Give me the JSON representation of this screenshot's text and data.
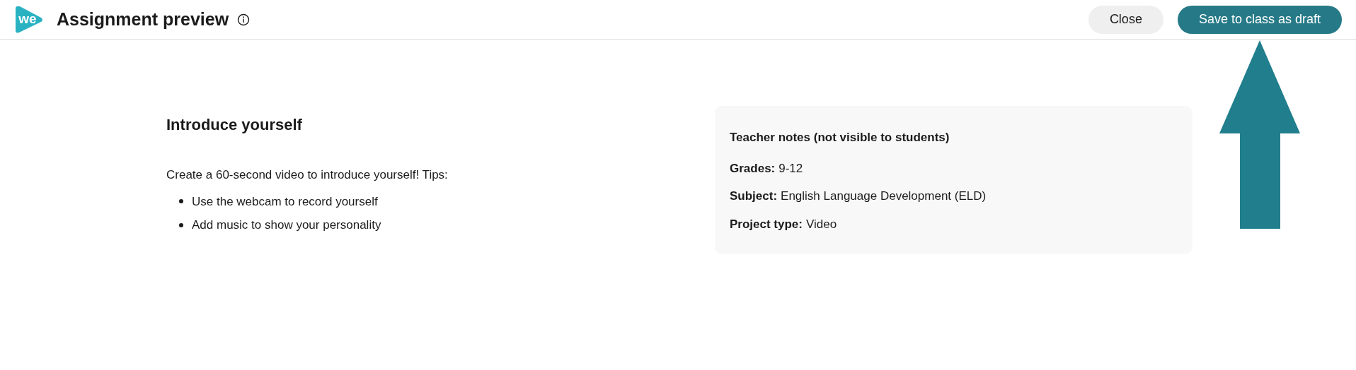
{
  "header": {
    "logo_text": "we",
    "title": "Assignment preview",
    "info_icon": true,
    "buttons": [
      {
        "label": "Close",
        "kind": "secondary"
      },
      {
        "label": "Save to class as draft",
        "kind": "primary"
      }
    ]
  },
  "assignment": {
    "title": "Introduce yourself",
    "description": "Create a 60-second video to introduce yourself! Tips:",
    "tips": [
      "Use the webcam to record yourself",
      "Add music to show your personality"
    ]
  },
  "teacher_notes": {
    "title": "Teacher notes (not visible to students)",
    "fields": [
      {
        "label": "Grades:",
        "value": "9-12"
      },
      {
        "label": "Subject:",
        "value": "English Language Development (ELD)"
      },
      {
        "label": "Project type:",
        "value": "Video"
      }
    ]
  },
  "annotation": {
    "kind": "up_arrow",
    "color": "#217e8c"
  }
}
